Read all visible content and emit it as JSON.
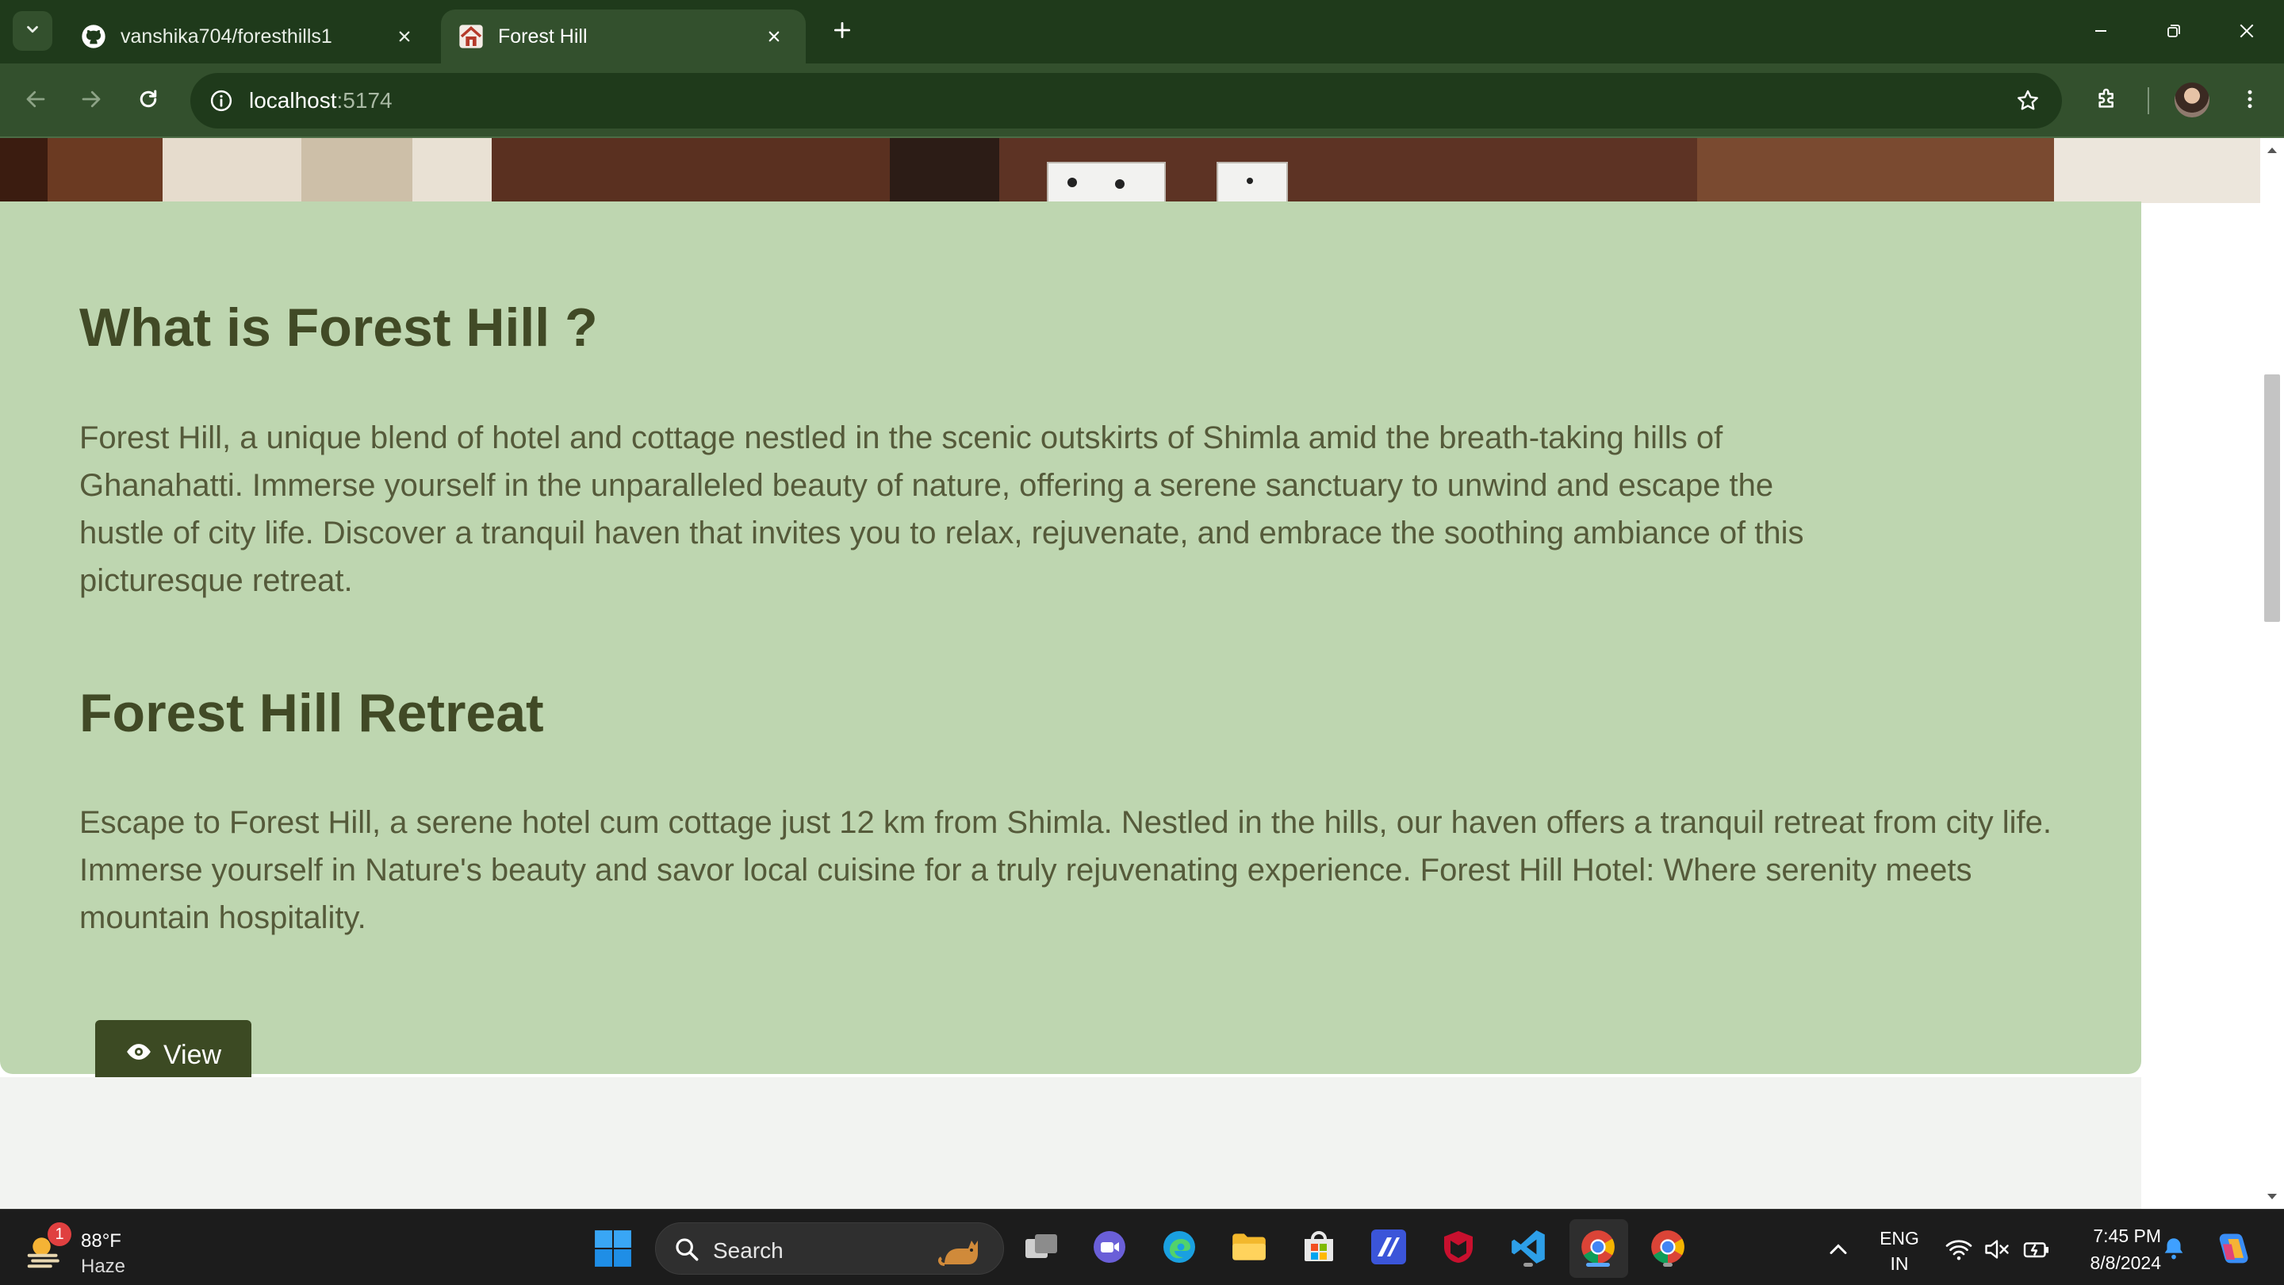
{
  "browser": {
    "tabs": [
      {
        "title": "vanshika704/foresthills1",
        "icon": "github-icon",
        "active": false
      },
      {
        "title": "Forest Hill",
        "icon": "house-icon",
        "active": true
      }
    ],
    "address": {
      "host": "localhost",
      "port": ":5174"
    },
    "theme_colors": {
      "frame": "#1f3a1b",
      "toolbar": "#33502d"
    }
  },
  "page": {
    "about": {
      "heading": "What is Forest Hill ?",
      "paragraph_lines": [
        "Forest Hill, a unique blend of hotel and cottage nestled in the scenic outskirts of Shimla amid the breath-taking hills of",
        "Ghanahatti. Immerse yourself in the unparalleled beauty of nature, offering a serene sanctuary to unwind and escape the",
        "hustle of city life. Discover a tranquil haven that invites you to relax, rejuvenate, and embrace the soothing ambiance of this",
        "picturesque retreat."
      ]
    },
    "retreat": {
      "heading": "Forest Hill Retreat",
      "paragraph_lines": [
        "Escape to Forest Hill, a serene hotel cum cottage just 12 km from Shimla. Nestled in the hills, our haven offers a tranquil retreat from city life.",
        "Immerse yourself in Nature's beauty and savor local cuisine for a truly rejuvenating experience. Forest Hill Hotel: Where serenity meets",
        "mountain hospitality."
      ],
      "button_label": "View",
      "button_icon": "eye-icon"
    },
    "colors": {
      "section_bg": "#bed6b0",
      "heading": "#414a26",
      "text": "#555a3a",
      "button_bg": "#3c4a23"
    }
  },
  "taskbar": {
    "weather": {
      "badge": "1",
      "temp": "88°F",
      "condition": "Haze"
    },
    "search_label": "Search",
    "language": {
      "line1": "ENG",
      "line2": "IN"
    },
    "clock": {
      "time": "7:45 PM",
      "date": "8/8/2024"
    }
  }
}
